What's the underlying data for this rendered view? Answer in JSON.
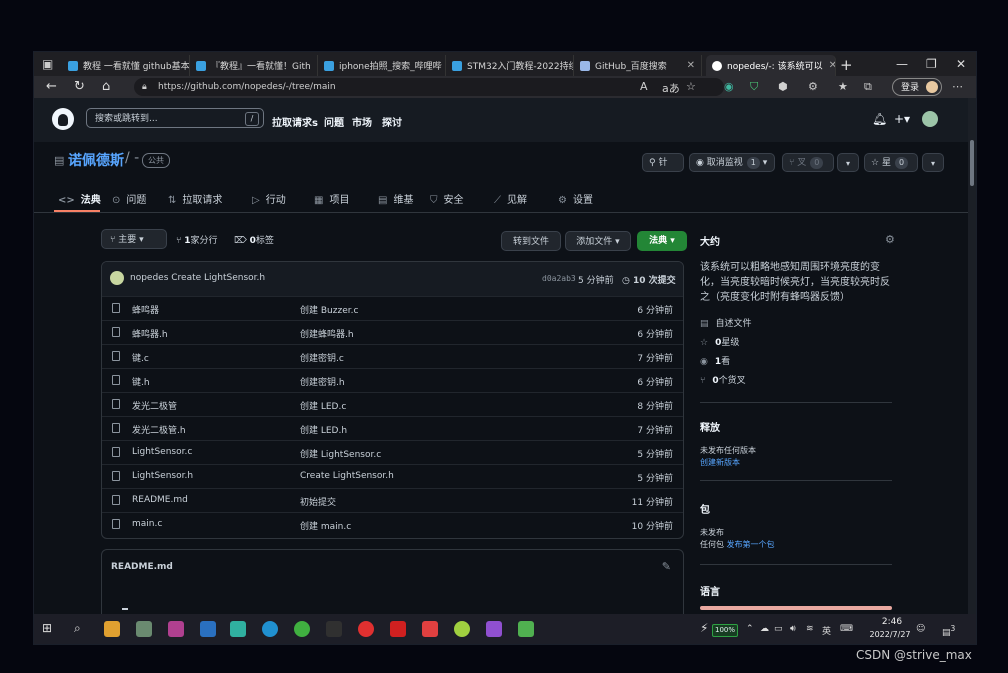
{
  "browser": {
    "tabs": [
      {
        "title": "教程 一看就懂 github基本",
        "icon_color": "#3aa0e0"
      },
      {
        "title": "『教程』一看就懂！Gith",
        "icon_color": "#3aa0e0"
      },
      {
        "title": "iphone拍照_搜索_哔哩哔",
        "icon_color": "#3aa0e0"
      },
      {
        "title": "STM32入门教程-2022持续",
        "icon_color": "#3aa0e0"
      },
      {
        "title": "GitHub_百度搜索",
        "icon_color": "#9ab8e8"
      },
      {
        "title": "nopedes/-: 该系统可以",
        "icon_color": "#ffffff"
      }
    ],
    "new_tab": "+",
    "url": "https://github.com/nopedes/-/tree/main",
    "login_label": "登录",
    "reader_icon": "A",
    "translate_icon": "aあ"
  },
  "github": {
    "search_placeholder": "搜索或跳转到...",
    "search_shortcut": "/",
    "nav": [
      "拉取请求s",
      "问题",
      "市场",
      "探讨"
    ],
    "repo": {
      "owner": "诺佩德斯",
      "sep": "/ -",
      "visibility": "公共",
      "pin_label": "针",
      "watch_label": "取消监视",
      "watch_count": "1",
      "fork_label": "叉",
      "fork_count": "0",
      "star_label": "星",
      "star_count": "0"
    },
    "tabs": [
      "法典",
      "问题",
      "拉取请求",
      "行动",
      "项目",
      "维基",
      "安全",
      "见解",
      "设置"
    ],
    "tab_icons": [
      "<>",
      "⊙",
      "⇅",
      "▷",
      "▦",
      "▤",
      "⛉",
      "⟋",
      "⚙"
    ],
    "toolbar": {
      "branch": "主要",
      "branch_count": "1",
      "branch_label": "家分行",
      "tags_count": "0",
      "tags_label": "标签",
      "goto_file": "转到文件",
      "add_file": "添加文件",
      "code": "法典"
    },
    "commit": {
      "message": "nopedes Create LightSensor.h",
      "hash": "d0a2ab3",
      "time": "5 分钟前",
      "count": "10 次提交"
    },
    "files": [
      {
        "name": "蜂鸣器",
        "message": "创建 Buzzer.c",
        "time": "6 分钟前"
      },
      {
        "name": "蜂鸣器.h",
        "message": "创建蜂鸣器.h",
        "time": "6 分钟前"
      },
      {
        "name": "键.c",
        "message": "创建密钥.c",
        "time": "7 分钟前"
      },
      {
        "name": "键.h",
        "message": "创建密钥.h",
        "time": "6 分钟前"
      },
      {
        "name": "发光二极管",
        "message": "创建 LED.c",
        "time": "8 分钟前"
      },
      {
        "name": "发光二极管.h",
        "message": "创建 LED.h",
        "time": "7 分钟前"
      },
      {
        "name": "LightSensor.c",
        "message": "创建 LightSensor.c",
        "time": "5 分钟前"
      },
      {
        "name": "LightSensor.h",
        "message": "Create LightSensor.h",
        "time": "5 分钟前"
      },
      {
        "name": "README.md",
        "message": "初始提交",
        "time": "11 分钟前"
      },
      {
        "name": "main.c",
        "message": "创建 main.c",
        "time": "10 分钟前"
      }
    ],
    "readme_title": "README.md",
    "sidebar": {
      "about_title": "大约",
      "description": "该系统可以粗略地感知周围环境亮度的变化，当亮度较暗时候亮灯，当亮度较亮时反之（亮度变化时附有蜂鸣器反馈）",
      "readme_link": "自述文件",
      "stars_value": "0",
      "stars_label": "星级",
      "watch_value": "1",
      "watch_label": "看",
      "forks_value": "0",
      "forks_label": "个货叉",
      "releases_title": "释放",
      "releases_none": "未发布任何版本",
      "releases_create": "创建新版本",
      "packages_title": "包",
      "packages_none": "未发布",
      "packages_text": "任何包",
      "packages_link": "发布第一个包",
      "languages_title": "语言"
    }
  },
  "taskbar": {
    "battery": "100%",
    "ime": "英",
    "time": "2:46",
    "date": "2022/7/27",
    "notif_count": "3"
  },
  "watermark": "CSDN @strive_max"
}
